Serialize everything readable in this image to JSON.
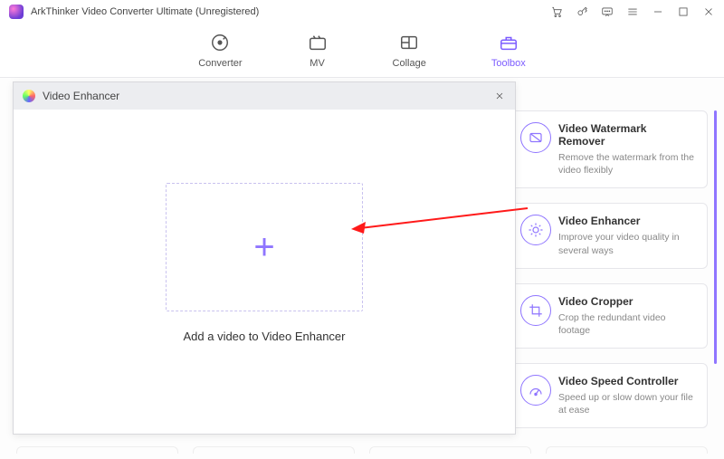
{
  "app": {
    "title": "ArkThinker Video Converter Ultimate (Unregistered)"
  },
  "tabs": {
    "converter": "Converter",
    "mv": "MV",
    "collage": "Collage",
    "toolbox": "Toolbox"
  },
  "dialog": {
    "title": "Video Enhancer",
    "drop_caption": "Add a video to Video Enhancer"
  },
  "cards": [
    {
      "title": "Video Watermark Remover",
      "desc": "Remove the watermark from the video flexibly"
    },
    {
      "title": "Video Enhancer",
      "desc": "Improve your video quality in several ways"
    },
    {
      "title": "Video Cropper",
      "desc": "Crop the redundant video footage"
    },
    {
      "title": "Video Speed Controller",
      "desc": "Speed up or slow down your file at ease"
    }
  ]
}
